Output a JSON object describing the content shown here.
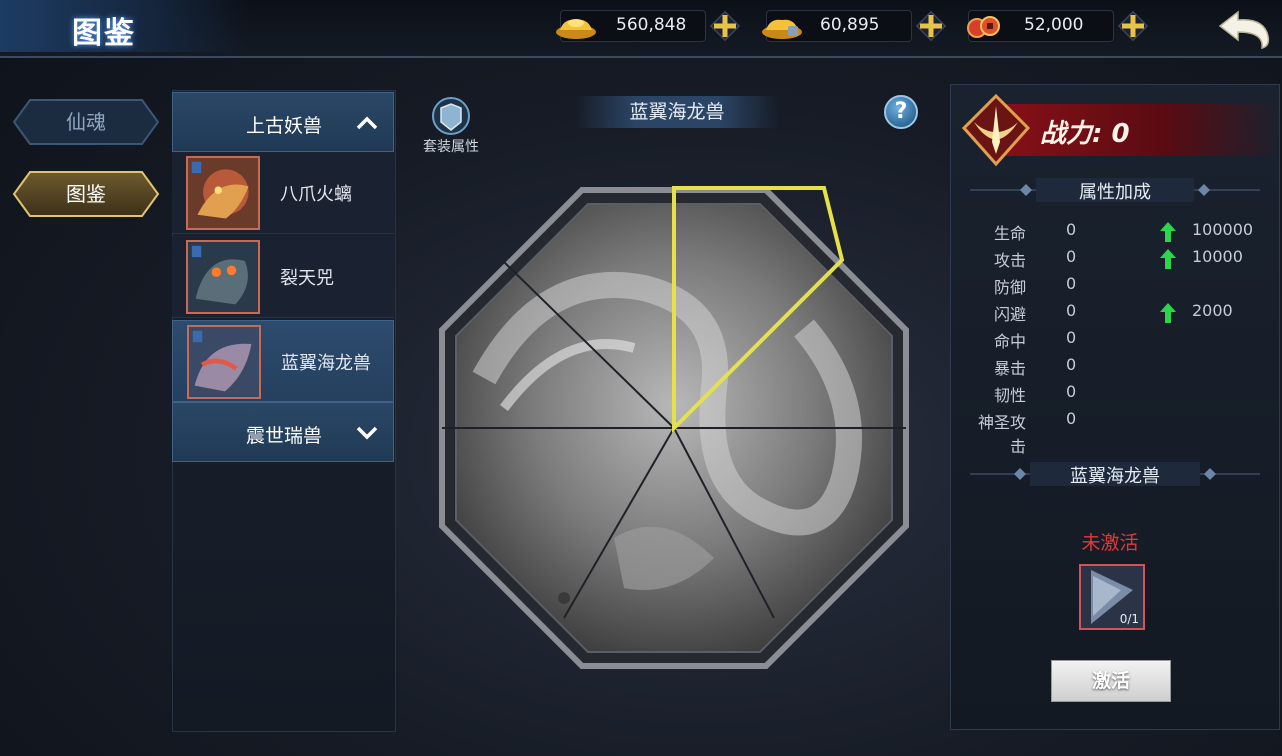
{
  "header": {
    "title": "图鉴",
    "currencies": [
      {
        "icon": "gold-ingot-icon",
        "value": "560,848"
      },
      {
        "icon": "bound-gold-ingot-icon",
        "value": "60,895"
      },
      {
        "icon": "copper-coin-icon",
        "value": "52,000"
      }
    ],
    "back_icon": "back-arrow-icon"
  },
  "side_tabs": [
    {
      "label": "仙魂",
      "active": false
    },
    {
      "label": "图鉴",
      "active": true
    }
  ],
  "beast_list": {
    "groups": [
      {
        "label": "上古妖兽",
        "expanded": true,
        "items": [
          {
            "name": "八爪火螭"
          },
          {
            "name": "裂天兕"
          },
          {
            "name": "蓝翼海龙兽",
            "selected": true
          }
        ]
      },
      {
        "label": "震世瑞兽",
        "expanded": false
      }
    ]
  },
  "center": {
    "title": "蓝翼海龙兽",
    "suit_button_label": "套装属性",
    "help_label": "?",
    "highlight_color": "#e6e04a"
  },
  "right_panel": {
    "power_label": "战力: 0",
    "attr_section_title": "属性加成",
    "attributes": [
      {
        "name": "生命",
        "value": "0",
        "bonus": "100000"
      },
      {
        "name": "攻击",
        "value": "0",
        "bonus": "10000"
      },
      {
        "name": "防御",
        "value": "0",
        "bonus": ""
      },
      {
        "name": "闪避",
        "value": "0",
        "bonus": "2000"
      },
      {
        "name": "命中",
        "value": "0",
        "bonus": ""
      },
      {
        "name": "暴击",
        "value": "0",
        "bonus": ""
      },
      {
        "name": "韧性",
        "value": "0",
        "bonus": ""
      },
      {
        "name": "神圣攻击",
        "value": "0",
        "bonus": ""
      }
    ],
    "beast_section_title": "蓝翼海龙兽",
    "status_text": "未激活",
    "fragment_count": "0/1",
    "activate_label": "激活",
    "bonus_arrow_color": "#2bd64a",
    "status_color": "#e03a3a"
  }
}
